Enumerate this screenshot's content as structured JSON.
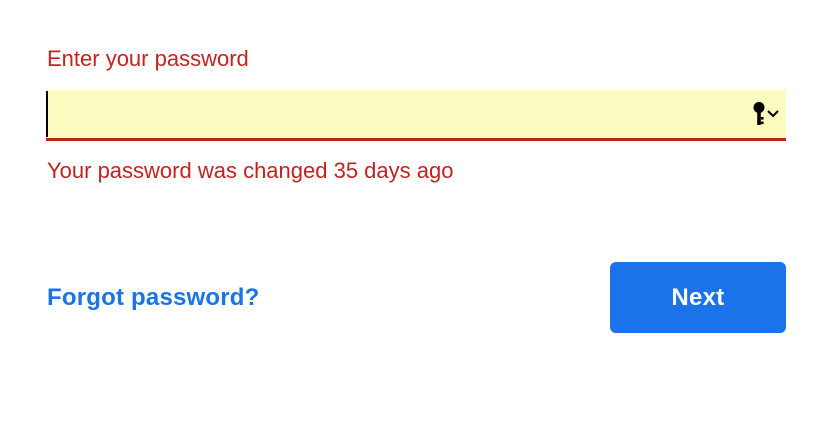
{
  "form": {
    "label": "Enter your password",
    "password_value": "",
    "error_message": "Your password was changed 35 days ago",
    "key_icon": "key-icon",
    "dropdown_icon": "chevron-down-icon"
  },
  "actions": {
    "forgot_label": "Forgot password?",
    "next_label": "Next"
  },
  "colors": {
    "error": "#c5221f",
    "accent": "#1a73e8",
    "autofill_background": "#fafcc0",
    "button_text": "#ffffff"
  }
}
